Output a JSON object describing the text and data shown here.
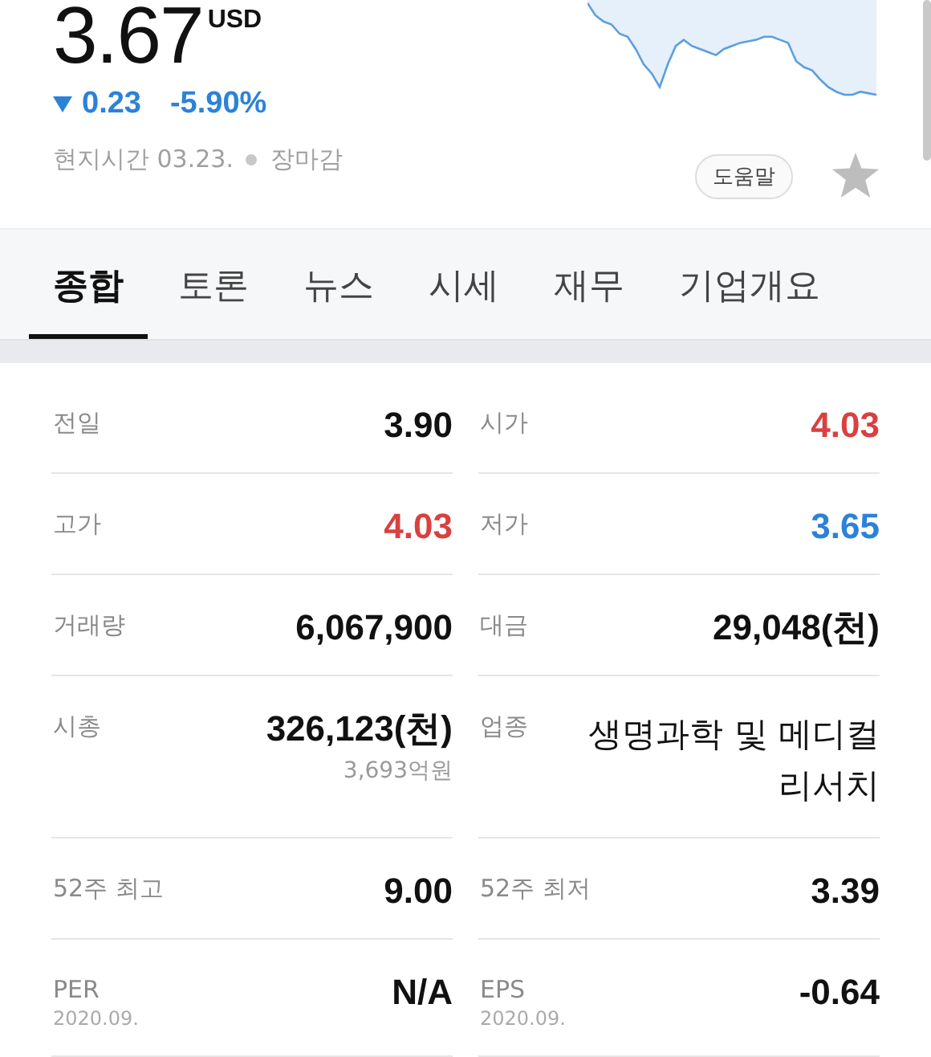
{
  "quote": {
    "price": "3.67",
    "currency": "USD",
    "falling": true,
    "change": "0.23",
    "change_rate": "-5.90%",
    "time": "현지시간 03.23.",
    "market_status": "장마감",
    "help_button": "도움말",
    "favorite": false
  },
  "tabs": [
    {
      "label": "종합",
      "selected": true
    },
    {
      "label": "토론",
      "selected": false
    },
    {
      "label": "뉴스",
      "selected": false
    },
    {
      "label": "시세",
      "selected": false
    },
    {
      "label": "재무",
      "selected": false
    },
    {
      "label": "기업개요",
      "selected": false
    }
  ],
  "stats": [
    {
      "label": "전일",
      "value": "3.90",
      "color": "#111111",
      "bold": true
    },
    {
      "label": "시가",
      "value": "4.03",
      "color": "#d9403f",
      "bold": true
    },
    {
      "label": "고가",
      "value": "4.03",
      "color": "#d9403f",
      "bold": true
    },
    {
      "label": "저가",
      "value": "3.65",
      "color": "#2b82d9",
      "bold": true
    },
    {
      "label": "거래량",
      "value": "6,067,900",
      "color": "#111111",
      "bold": true
    },
    {
      "label": "대금",
      "value": "29,048(천)",
      "color": "#111111",
      "bold": true
    },
    {
      "label": "시총",
      "value": "326,123(천)",
      "note": "3,693억원",
      "color": "#111111",
      "bold": true
    },
    {
      "label": "업종",
      "value": "생명과학 및 메디컬리서치",
      "color": "#111111",
      "bold": false
    },
    {
      "label": "52주 최고",
      "value": "9.00",
      "color": "#111111",
      "bold": true
    },
    {
      "label": "52주 최저",
      "value": "3.39",
      "color": "#111111",
      "bold": true
    },
    {
      "label": "PER",
      "date": "2020.09.",
      "value": "N/A",
      "color": "#111111",
      "bold": true
    },
    {
      "label": "EPS",
      "date": "2020.09.",
      "value": "-0.64",
      "color": "#111111",
      "bold": true
    }
  ]
}
